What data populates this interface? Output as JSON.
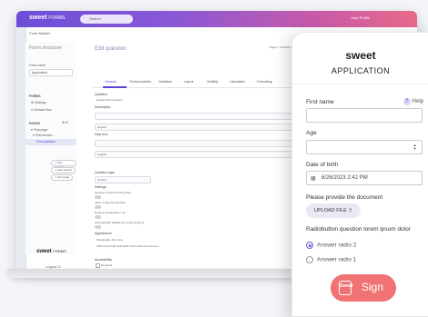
{
  "builder": {
    "logo": "sweet",
    "logo_sub": "FORMS",
    "search_placeholder": "Search",
    "topbar_right": "Help  Profile",
    "sidebar": {
      "header": "Form Builder",
      "form_structure": "Form structure",
      "form_name_label": "Form name",
      "form_name_value": "Application",
      "forms_heading": "FORMS",
      "settings_item": "Settings",
      "answers_item": "Answer flow",
      "pages_heading": "PAGES",
      "first_page": "First page",
      "first_section": "First section",
      "field_item": "First question",
      "add_buttons": [
        "+ New question",
        "+ New section",
        "+ New page"
      ],
      "brand": "sweet",
      "brand_sub": "FORMS",
      "logout": "Logout"
    },
    "main": {
      "title": "Edit question",
      "page_info": "Page 1 · Section 1 · Question 1",
      "tabs": [
        "General",
        "Field properties",
        "Validation",
        "Layout",
        "Visibility",
        "Calculation",
        "Formatting"
      ],
      "labels": {
        "question": "Question",
        "description": "Description",
        "helptext": "Help text",
        "question_type": "Question type",
        "settings": "Settings",
        "appearance": "Appearance",
        "accessibility": "Accessibility"
      },
      "question_value": "English    First question",
      "lang_value": "English",
      "type_value": "Textbox",
      "settings_lines": [
        "Question is the first thing filled",
        "Allow to skip this question",
        "Require explanation if not",
        "Automatically validate the input as typed"
      ],
      "appearance_rows": [
        "Placeholder   Text here",
        "Width   Full width   Half width   Third width   Auto   Custom"
      ],
      "required_label": "Required"
    }
  },
  "form": {
    "brand": "sweet",
    "title": "APPLICATION",
    "help_label": "Help",
    "help_icon": "?",
    "first_name_label": "First name",
    "age_label": "Age",
    "dob_label": "Date of birth",
    "dob_value": "6/26/2023 2:42 PM",
    "document_label": "Please provide the document",
    "upload_label": "UPLOAD FILE",
    "radio_question": "Radiobutton question lorem ipsum dolor",
    "radio_options": [
      {
        "label": "Answer radio 2",
        "checked": true
      },
      {
        "label": "Answer radio 1",
        "checked": false
      }
    ],
    "sign_label": "Sign",
    "sign_icon_text": "Sweet",
    "accent": "#6b53d9",
    "sign_color": "#f07272"
  }
}
